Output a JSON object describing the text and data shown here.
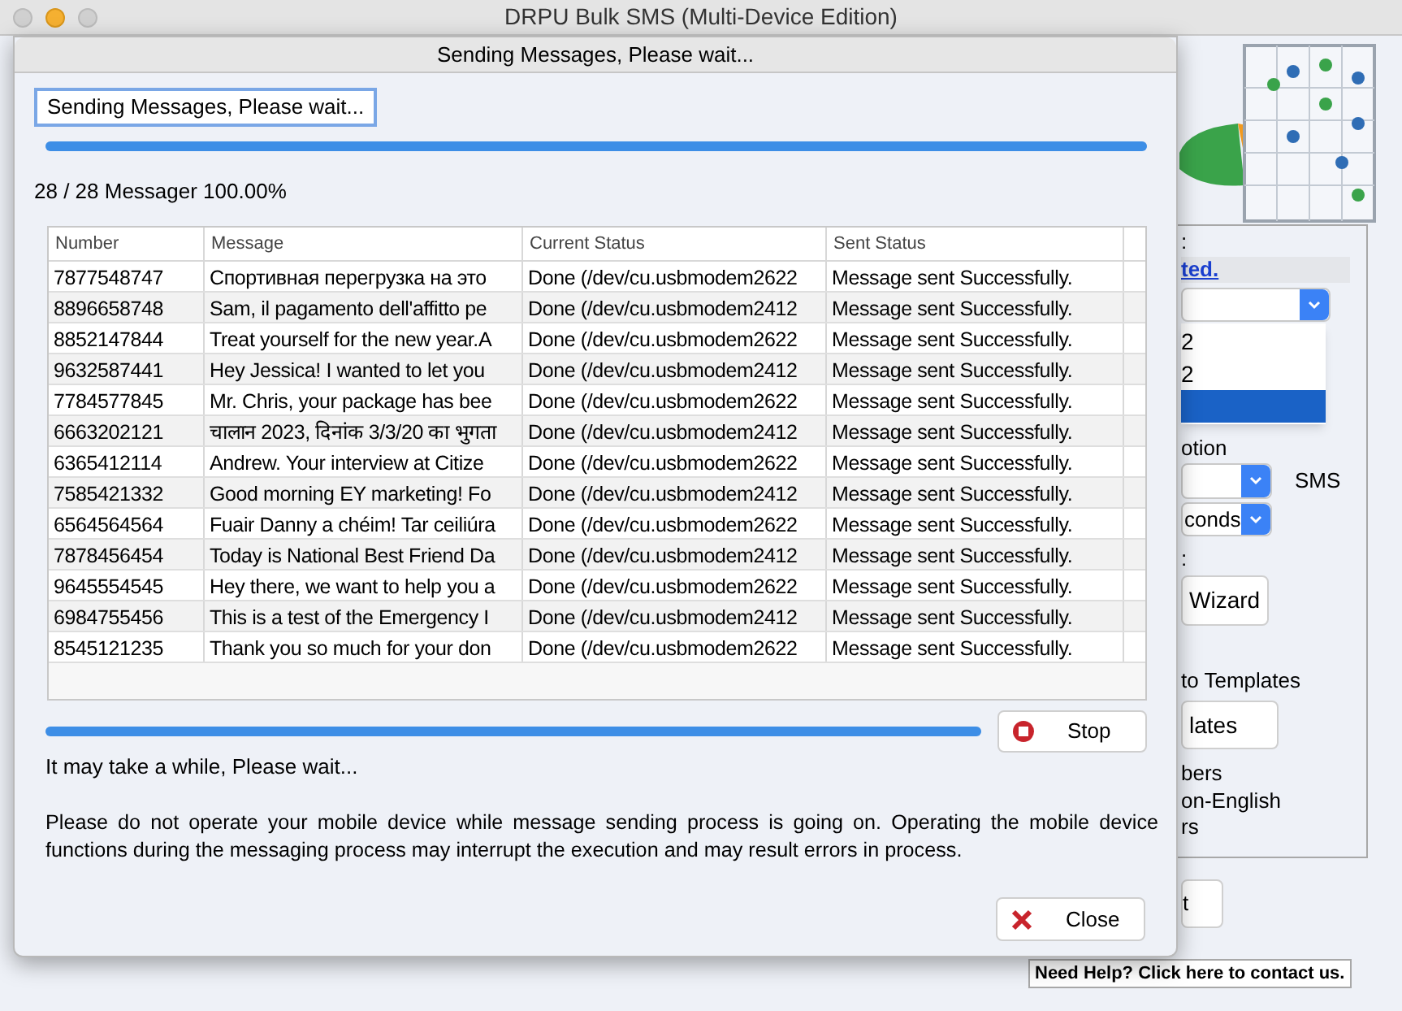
{
  "window": {
    "title": "DRPU Bulk SMS (Multi-Device Edition)"
  },
  "background": {
    "label_1": ":",
    "link": "ted.",
    "dropdown_list": [
      {
        "text": "2",
        "selected": false
      },
      {
        "text": "2",
        "selected": false
      },
      {
        "selected": true
      }
    ],
    "option_label": "otion",
    "sms_label": "SMS",
    "interval_value": "conds",
    "label_2": ":",
    "wizard_button": "Wizard",
    "templates_label": "to Templates",
    "templates_button": "lates",
    "numbers_label": "bers",
    "non_english_label": "on-English",
    "rs_label": "rs",
    "button_3": "t",
    "help_link": "Need Help? Click here to contact us."
  },
  "dialog": {
    "title": "Sending Messages, Please wait...",
    "status_box": "Sending Messages, Please wait...",
    "progress": {
      "level": 1
    },
    "count_text": "28 / 28 Messager 100.00%",
    "table": {
      "columns": [
        "Number",
        "Message",
        "Current Status",
        "Sent Status"
      ],
      "rows": [
        [
          "7877548747",
          "Спортивная перегрузка на это",
          "Done (/dev/cu.usbmodem2622",
          "Message sent Successfully."
        ],
        [
          "8896658748",
          "Sam, il pagamento dell'affitto pe",
          "Done (/dev/cu.usbmodem2412",
          "Message sent Successfully."
        ],
        [
          "8852147844",
          "Treat yourself for the new year.A",
          "Done (/dev/cu.usbmodem2622",
          "Message sent Successfully."
        ],
        [
          "9632587441",
          "Hey Jessica! I wanted to let you",
          "Done (/dev/cu.usbmodem2412",
          "Message sent Successfully."
        ],
        [
          "7784577845",
          "Mr. Chris, your package has bee",
          "Done (/dev/cu.usbmodem2622",
          "Message sent Successfully."
        ],
        [
          "6663202121",
          "चालान 2023, दिनांक 3/3/20 का भुगता",
          "Done (/dev/cu.usbmodem2412",
          "Message sent Successfully."
        ],
        [
          "6365412114",
          "Andrew. Your interview at Citize",
          "Done (/dev/cu.usbmodem2622",
          "Message sent Successfully."
        ],
        [
          "7585421332",
          "Good morning EY marketing! Fo",
          "Done (/dev/cu.usbmodem2412",
          "Message sent Successfully."
        ],
        [
          "6564564564",
          "Fuair Danny a chéim! Tar ceiliúra",
          "Done (/dev/cu.usbmodem2622",
          "Message sent Successfully."
        ],
        [
          "7878456454",
          "Today is National Best Friend Da",
          "Done (/dev/cu.usbmodem2412",
          "Message sent Successfully."
        ],
        [
          "9645554545",
          "Hey there, we want to help you a",
          "Done (/dev/cu.usbmodem2622",
          "Message sent Successfully."
        ],
        [
          "6984755456",
          "This is a test of the Emergency I",
          "Done (/dev/cu.usbmodem2412",
          "Message sent Successfully."
        ],
        [
          "8545121235",
          "Thank you so much for your don",
          "Done (/dev/cu.usbmodem2622",
          "Message sent Successfully."
        ]
      ]
    },
    "progress_2": {
      "level": 1
    },
    "stop_button": "Stop",
    "wait_text": "It may take a while, Please wait...",
    "notice": "Please do not operate your mobile device while message sending process is going on. Operating the mobile device functions during the messaging process may interrupt the execution and may result errors in process.",
    "close_button": "Close"
  }
}
